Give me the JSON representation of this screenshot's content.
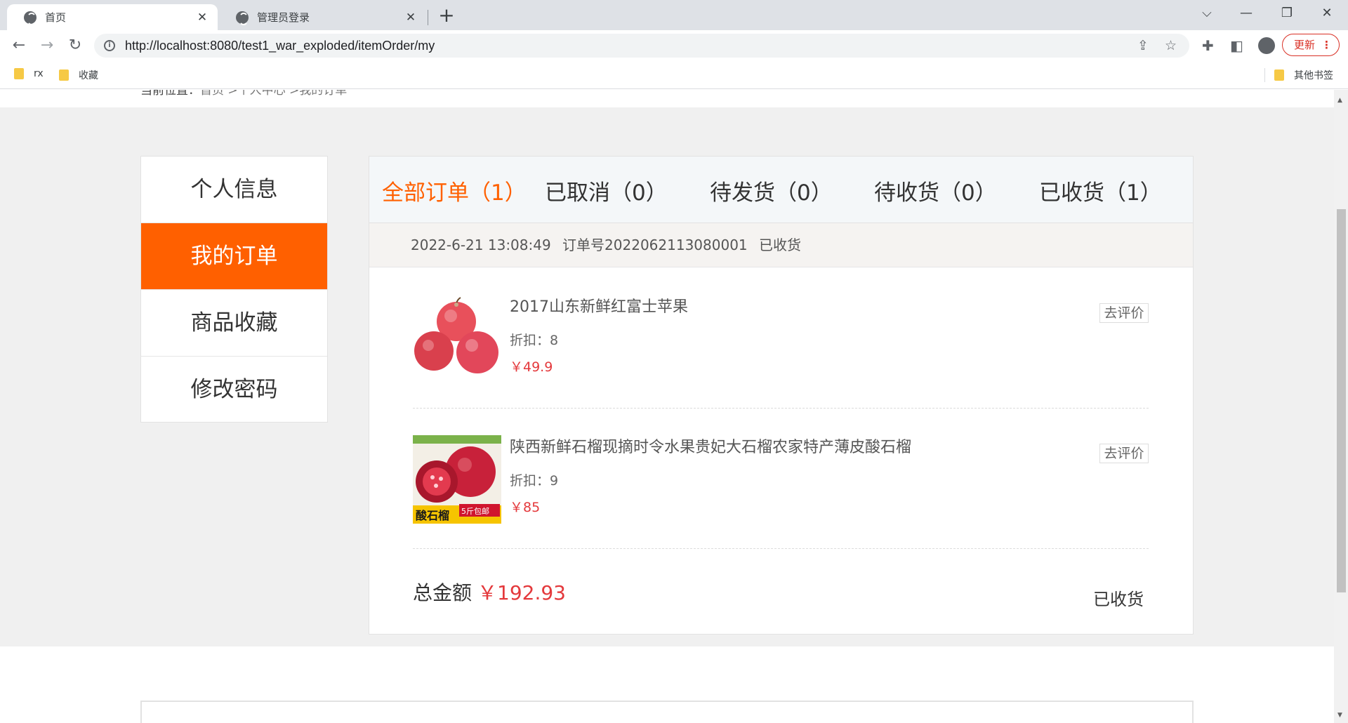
{
  "browser": {
    "tabs": [
      {
        "title": "首页",
        "close": "✕"
      },
      {
        "title": "管理员登录",
        "close": "✕"
      }
    ],
    "new_tab": "+",
    "window_controls": {
      "list": "⌵",
      "minimize": "—",
      "restore": "❐",
      "close": "✕"
    },
    "nav": {
      "back": "←",
      "forward": "→",
      "reload": "↻"
    },
    "url": "http://localhost:8080/test1_war_exploded/itemOrder/my",
    "update_label": "更新",
    "menu_dots": "⋮",
    "bookmarks": [
      "rx",
      "收藏"
    ],
    "other_bookmarks": "其他书签",
    "icons": [
      "info-icon",
      "share-icon",
      "star-icon",
      "extensions-icon",
      "side-panel-icon",
      "profile-icon"
    ]
  },
  "breadcrumb": {
    "prefix": "当前位置：",
    "items": [
      "首页",
      " >个人中心",
      " >我的订单"
    ]
  },
  "side_menu": [
    {
      "label": "个人信息",
      "active": false
    },
    {
      "label": "我的订单",
      "active": true
    },
    {
      "label": "商品收藏",
      "active": false
    },
    {
      "label": "修改密码",
      "active": false
    }
  ],
  "order_tabs": [
    {
      "label": "全部订单（1）",
      "active": true
    },
    {
      "label": "已取消（0）",
      "active": false
    },
    {
      "label": "待发货（0）",
      "active": false
    },
    {
      "label": "待收货（0）",
      "active": false
    },
    {
      "label": "已收货（1）",
      "active": false
    }
  ],
  "order": {
    "time": "2022-6-21 13:08:49",
    "number": "订单号2022062113080001",
    "status": "已收货",
    "items": [
      {
        "name": "2017山东新鲜红富士苹果",
        "discount": "折扣：8",
        "price": "￥49.9",
        "review": "去评价",
        "image": "apple-image"
      },
      {
        "name": "陕西新鲜石榴现摘时令水果贵妃大石榴农家特产薄皮酸石榴",
        "discount": "折扣：9",
        "price": "￥85",
        "review": "去评价",
        "image": "pomegranate-image",
        "image_text": "酸石榴",
        "image_badge": "5斤包邮"
      }
    ],
    "total_label": "总金额",
    "total_amount": "￥192.93",
    "final_status": "已收货"
  },
  "colors": {
    "accent": "#ff6000",
    "price": "#e4393c",
    "page_bg": "#f0f0f0"
  }
}
